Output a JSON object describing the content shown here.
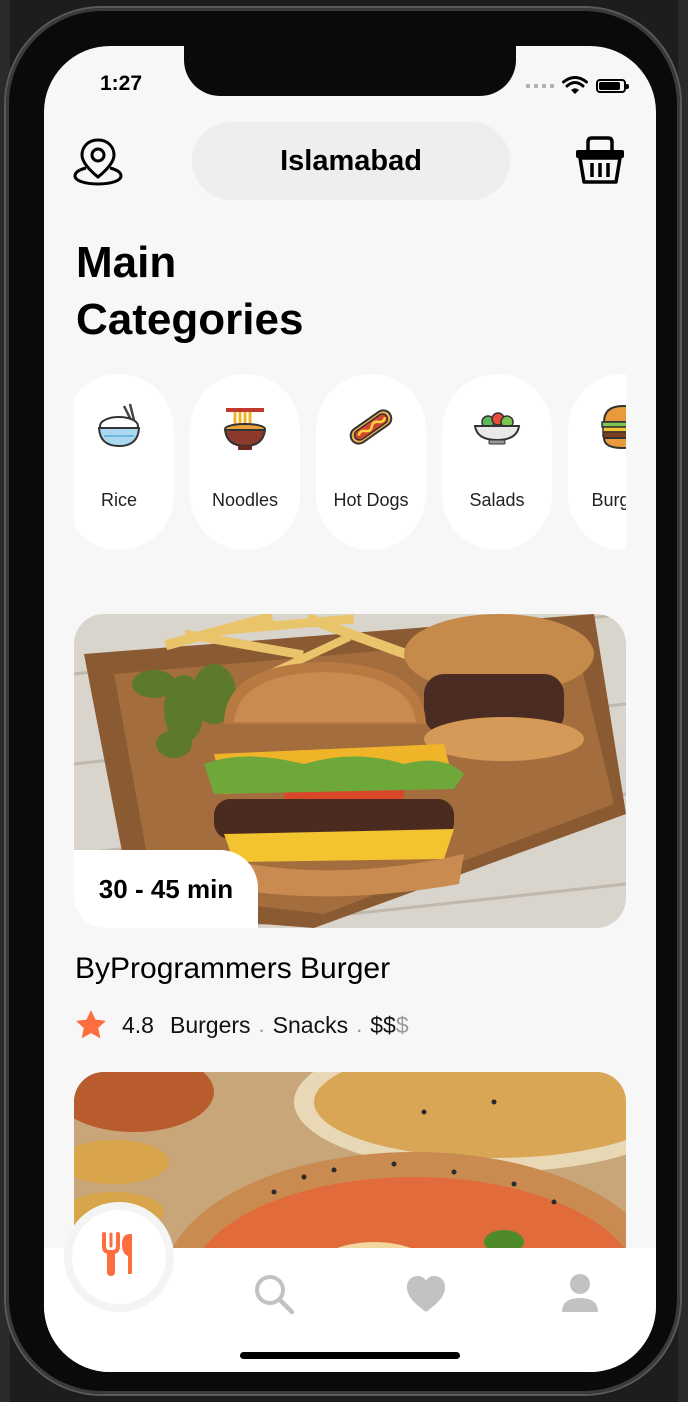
{
  "status_bar": {
    "time": "1:27"
  },
  "header": {
    "location_icon": "location-pin-icon",
    "city": "Islamabad",
    "basket_icon": "basket-icon"
  },
  "title": {
    "line1": "Main",
    "line2": "Categories"
  },
  "categories": [
    {
      "label": "Rice",
      "icon": "rice-bowl-icon"
    },
    {
      "label": "Noodles",
      "icon": "noodles-icon"
    },
    {
      "label": "Hot Dogs",
      "icon": "hotdog-icon"
    },
    {
      "label": "Salads",
      "icon": "salad-icon"
    },
    {
      "label": "Burgers",
      "icon": "burger-icon"
    }
  ],
  "restaurant": {
    "delivery_time": "30 - 45 min",
    "name": "ByProgrammers Burger",
    "rating": "4.8",
    "tags": [
      "Burgers",
      "Snacks"
    ],
    "price_active": "$$",
    "price_inactive": "$"
  },
  "tabbar": {
    "items": [
      "fork-knife-icon",
      "search-icon",
      "heart-icon",
      "user-icon"
    ]
  },
  "colors": {
    "accent": "#FC6D3F",
    "inactive": "#9a9a9a"
  }
}
